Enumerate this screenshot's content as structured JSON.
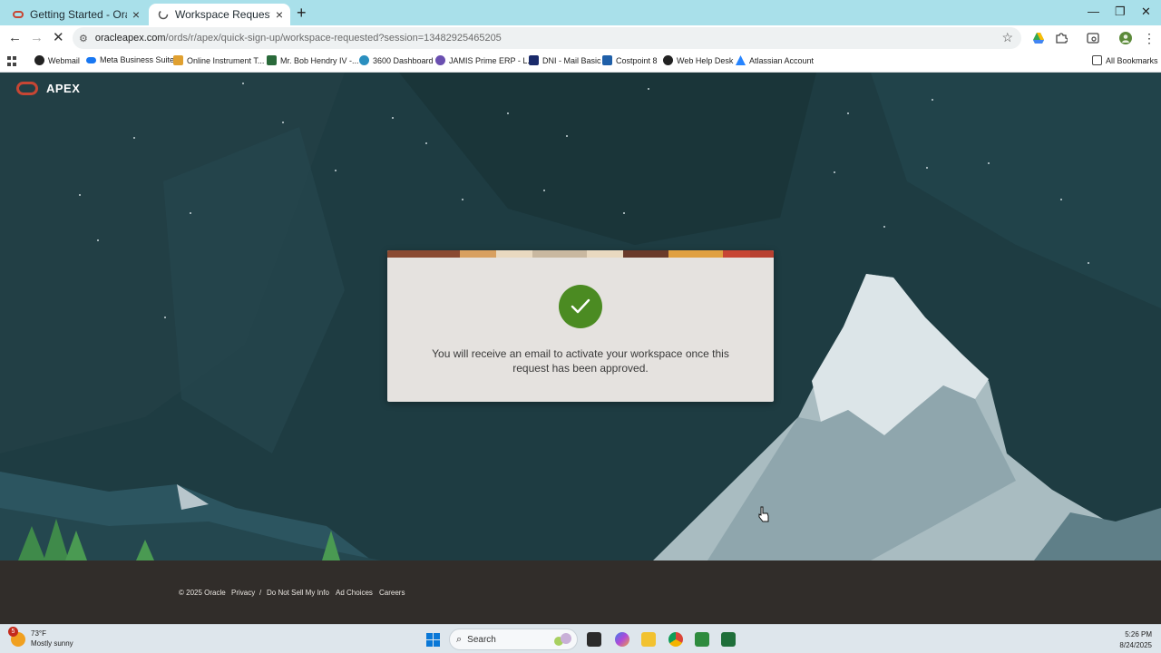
{
  "browser": {
    "tabs": [
      {
        "label": "Getting Started - Oracle APEX",
        "active": false
      },
      {
        "label": "Workspace Requested",
        "active": true
      }
    ],
    "new_tab": "+",
    "url_host": "oracleapex.com",
    "url_path": "/ords/r/apex/quick-sign-up/workspace-requested?session=13482925465205",
    "bookmarks": [
      {
        "label": "Webmail",
        "icon": "globe-icon",
        "color": "#222222"
      },
      {
        "label": "Meta Business Suite",
        "icon": "meta-icon",
        "color": "#1877f2"
      },
      {
        "label": "Online Instrument T...",
        "icon": "instrument-icon",
        "color": "#e0a030"
      },
      {
        "label": "Mr. Bob Hendry IV -...",
        "icon": "bookmark-site-icon",
        "color": "#2a6a3a"
      },
      {
        "label": "3600 Dashboard",
        "icon": "dashboard-icon",
        "color": "#2a8fbf"
      },
      {
        "label": "JAMIS Prime ERP - L...",
        "icon": "jamis-icon",
        "color": "#6a4fb0"
      },
      {
        "label": "DNI - Mail Basic",
        "icon": "mail-icon",
        "color": "#1a2a6a"
      },
      {
        "label": "Costpoint 8",
        "icon": "costpoint-icon",
        "color": "#1f5fa8"
      },
      {
        "label": "Web Help Desk",
        "icon": "globe-icon",
        "color": "#222222"
      },
      {
        "label": "Atlassian Account",
        "icon": "atlassian-icon",
        "color": "#2684ff"
      }
    ],
    "all_bookmarks": "All Bookmarks"
  },
  "page": {
    "logo": "APEX",
    "message": "You will receive an email to activate your workspace once this request has been approved.",
    "accent": "#4b8b22",
    "brand": "#c74634"
  },
  "footer": {
    "copyright": "© 2025 Oracle",
    "privacy": "Privacy",
    "separator": "/",
    "do_not_sell": "Do Not Sell My Info",
    "ad_choices": "Ad Choices",
    "careers": "Careers"
  },
  "taskbar": {
    "weather_badge": "5",
    "temperature": "73°F",
    "condition": "Mostly sunny",
    "search_label": "Search",
    "time": "5:26 PM",
    "date": "8/24/2025"
  }
}
